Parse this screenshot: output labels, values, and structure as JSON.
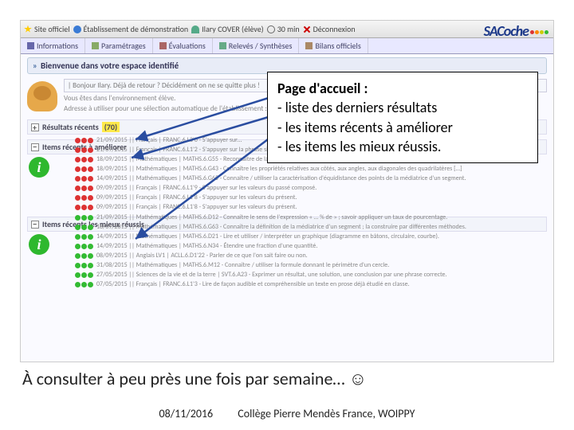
{
  "toolbar": {
    "site": "Site officiel",
    "etab": "Établissement de démonstration",
    "user": "Ilary COVER (élève)",
    "timer": "30 min",
    "logout": "Déconnexion"
  },
  "logo": {
    "text": "SACoche"
  },
  "tabs": [
    "Informations",
    "Paramétrages",
    "Évaluations",
    "Relevés / Synthèses",
    "Bilans officiels"
  ],
  "welcome": "Bienvenue dans votre espace identifié",
  "greeting_line": "| Bonjour Ilary. Déjà de retour ? Décidément on ne se quitte plus !",
  "env_line": "Vous êtes dans l'environnement élève.",
  "address_line": "Adresse à utiliser pour une sélection automatique de l'établissement :",
  "sections": {
    "recents": {
      "label": "Résultats récents",
      "count": "(70)"
    },
    "ameliorer": "Items récents à améliorer",
    "reussis": "Items récents les mieux réussis"
  },
  "rows_ameliorer": [
    "21/09/2015 || Français | FRANC.6.L3'0 - S'appuyer sur…",
    "21/09/2015 || Français | FRANC.6.L1'2 - S'appuyer sur la phrase simple et ses principaux…",
    "18/09/2015 || Mathématiques | MATHS.6.G55 - Reconnaître de la bissectrice d'un angle, la construire par différentes méthodes.",
    "18/09/2015 || Mathématiques | MATHS.6.G43 - Connaître les propriétés relatives aux côtés, aux angles, aux diagonales des quadrilatères […]",
    "14/09/2015 || Mathématiques | MATHS.6.G65 - Connaître / utiliser la caractérisation d'équidistance des points de la médiatrice d'un segment.",
    "09/09/2015 || Français | FRANC.6.L1'9 - S'appuyer sur les valeurs du passé composé.",
    "09/09/2015 || Français | FRANC.6.L1'8 - S'appuyer sur les valeurs du présent.",
    "09/09/2015 || Français | FRANC.6.L1'8 - S'appuyer sur les valeurs du présent."
  ],
  "rows_reussis": [
    "21/09/2015 || Mathématiques | MATHS.6.D12 - Connaître le sens de l'expression « … % de » ; savoir appliquer un taux de pourcentage.",
    "18/09/2015 || Mathématiques | MATHS.6.G63 - Connaître la définition de la médiatrice d'un segment ; la construire par différentes méthodes.",
    "14/09/2015 || Mathématiques | MATHS.6.D21 - Lire et utiliser / interpréter un graphique (diagramme en bâtons, circulaire, courbe).",
    "14/09/2015 || Mathématiques | MATHS.6.N34 - Étendre une fraction d'une quantité.",
    "08/09/2015 || Anglais LV1 | ACLL.6.D1'22 - Parler de ce que l'on sait faire ou non.",
    "31/08/2015 || Mathématiques | MATHS.6.M12 - Connaître / utiliser la formule donnant le périmètre d'un cercle.",
    "27/05/2015 || Sciences de la vie et de la terre | SVT.6.A23 - Exprimer un résultat, une solution, une conclusion par une phrase correcte.",
    "07/05/2015 || Français | FRANC.6.L1'3 - Lire de façon audible et compréhensible un texte en prose déjà étudié en classe."
  ],
  "callout": {
    "title": "Page d'accueil :",
    "line1": "- liste des derniers résultats",
    "line2": "- les items récents à améliorer",
    "line3": "- les items les mieux réussis."
  },
  "bottom": "À consulter à peu près une fois par semaine… ☺",
  "footer": {
    "date": "08/11/2016",
    "place": "Collège Pierre Mendès France, WOIPPY"
  }
}
